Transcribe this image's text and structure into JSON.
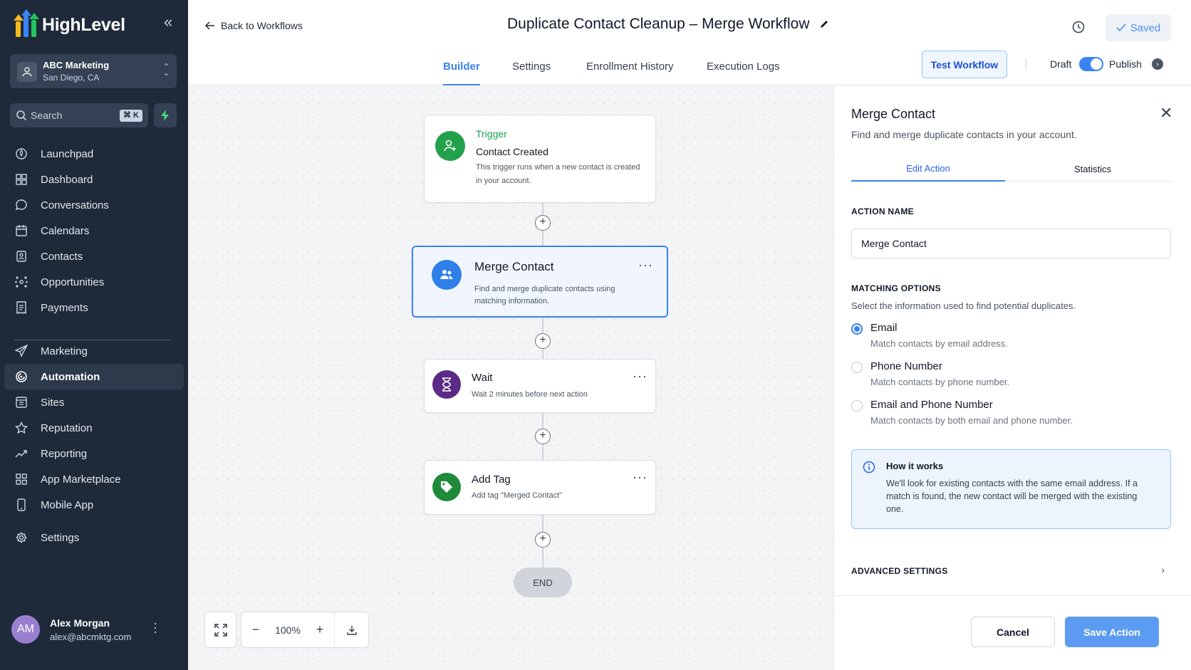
{
  "brand": {
    "name": "HighLevel"
  },
  "account": {
    "name": "ABC Marketing",
    "location": "San Diego, CA"
  },
  "search": {
    "placeholder": "Search",
    "shortcut": "⌘ K"
  },
  "nav": {
    "items": [
      {
        "label": "Launchpad",
        "icon": "rocket-icon"
      },
      {
        "label": "Dashboard",
        "icon": "grid-icon"
      },
      {
        "label": "Conversations",
        "icon": "chat-icon"
      },
      {
        "label": "Calendars",
        "icon": "calendar-icon"
      },
      {
        "label": "Contacts",
        "icon": "contacts-icon"
      },
      {
        "label": "Opportunities",
        "icon": "opportunities-icon"
      },
      {
        "label": "Payments",
        "icon": "receipt-icon"
      },
      {
        "label": "Marketing",
        "icon": "send-icon"
      },
      {
        "label": "Automation",
        "icon": "automation-icon",
        "active": true
      },
      {
        "label": "Sites",
        "icon": "sites-icon"
      },
      {
        "label": "Reputation",
        "icon": "star-icon"
      },
      {
        "label": "Reporting",
        "icon": "trend-icon"
      },
      {
        "label": "App Marketplace",
        "icon": "apps-icon"
      },
      {
        "label": "Mobile App",
        "icon": "phone-icon"
      },
      {
        "label": "Settings",
        "icon": "gear-icon"
      }
    ]
  },
  "user": {
    "initials": "AM",
    "name": "Alex Morgan",
    "email": "alex@abcmktg.com"
  },
  "header": {
    "back_label": "Back to Workflows",
    "title": "Duplicate Contact Cleanup – Merge Workflow",
    "saved_label": "Saved",
    "tabs": [
      "Builder",
      "Settings",
      "Enrollment History",
      "Execution Logs"
    ],
    "active_tab": "Builder",
    "test_label": "Test Workflow",
    "draft_label": "Draft",
    "publish_label": "Publish",
    "published": true
  },
  "workflow": {
    "trigger": {
      "kind": "Trigger",
      "title": "Contact Created",
      "desc_line1": "This trigger runs when a new contact is created",
      "desc_line2": "in your account."
    },
    "steps": [
      {
        "title": "Merge Contact",
        "desc_line1": "Find and merge duplicate contacts using",
        "desc_line2": "matching information.",
        "color": "#2f7fe8"
      },
      {
        "title": "Wait",
        "desc_line1": "Wait 2 minutes before next action",
        "color": "#5b2a86"
      },
      {
        "title": "Add Tag",
        "desc_line1": "Add tag \"Merged Contact\"",
        "color": "#1f8b3a"
      }
    ],
    "end_label": "END",
    "trigger_color": "#22a04b"
  },
  "zoom": {
    "level": "100%"
  },
  "panel": {
    "title": "Merge Contact",
    "subtitle": "Find and merge duplicate contacts in your account.",
    "tabs": [
      "Edit Action",
      "Statistics"
    ],
    "action_name_label": "ACTION NAME",
    "action_name_value": "Merge Contact",
    "matching_label": "MATCHING OPTIONS",
    "matching_help": "Select the information used to find potential duplicates.",
    "options": [
      {
        "label": "Email",
        "desc": "Match contacts by email address.",
        "checked": true
      },
      {
        "label": "Phone Number",
        "desc": "Match contacts by phone number.",
        "checked": false
      },
      {
        "label": "Email and Phone Number",
        "desc": "Match contacts by both email and phone number.",
        "checked": false
      }
    ],
    "info_title": "How it works",
    "info_text": "We'll look for existing contacts with the same email address. If a match is found, the new contact will be merged with the existing one.",
    "advanced_label": "ADVANCED SETTINGS",
    "cancel_label": "Cancel",
    "save_label": "Save Action"
  },
  "colors": {
    "accent": "#3b82f6",
    "sidebar": "#1e2a3a"
  }
}
